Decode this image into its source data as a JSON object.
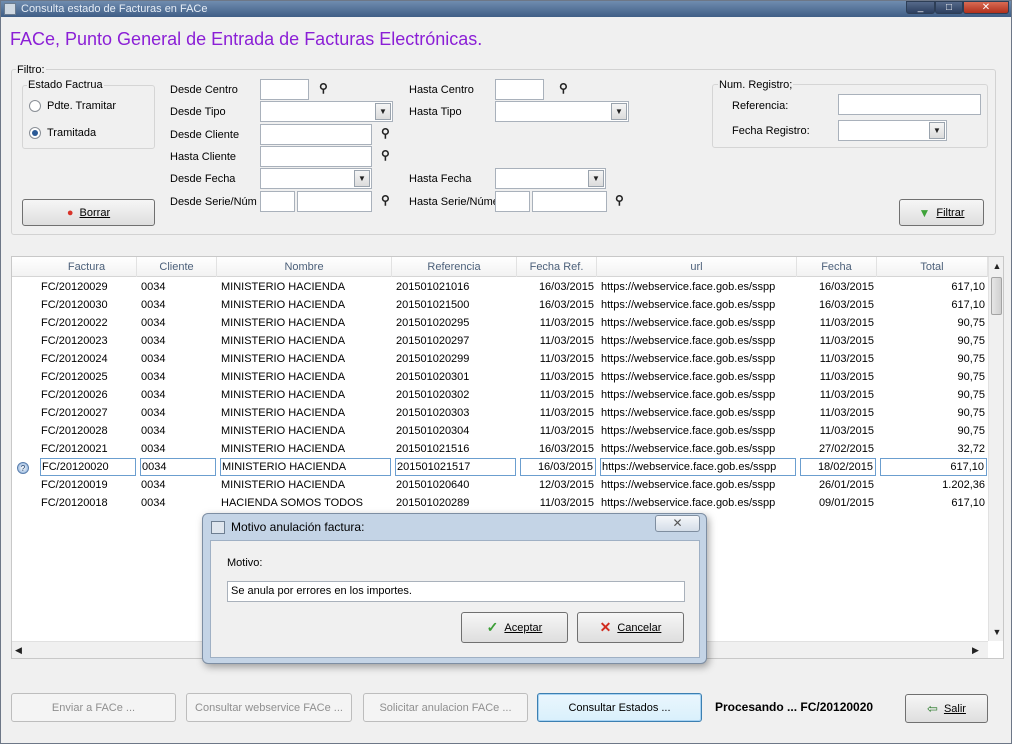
{
  "window": {
    "title": "Consulta estado de Facturas en FACe",
    "controls": [
      "_",
      "□",
      "✕"
    ]
  },
  "header": {
    "title": "FACe, Punto General de Entrada de Facturas Electrónicas."
  },
  "filter": {
    "legend": "Filtro:",
    "estado": {
      "legend": "Estado Factrua",
      "option1": "Pdte. Tramitar",
      "option2": "Tramitada",
      "selected": "Tramitada"
    },
    "labels": {
      "desde_centro": "Desde Centro",
      "hasta_centro": "Hasta Centro",
      "desde_tipo": "Desde Tipo",
      "hasta_tipo": "Hasta Tipo",
      "desde_cliente": "Desde Cliente",
      "hasta_cliente": "Hasta Cliente",
      "desde_fecha": "Desde Fecha",
      "hasta_fecha": "Hasta Fecha",
      "desde_serie": "Desde Serie/Núm",
      "hasta_serie": "Hasta Serie/Núme"
    },
    "registro": {
      "legend": "Num. Registro;",
      "referencia": "Referencia:",
      "fecha_registro": "Fecha Registro:"
    },
    "binoculars": "⚲",
    "borrar_label": "Borrar",
    "filtrar_label": "Filtrar"
  },
  "grid": {
    "columns": [
      "Factura",
      "Cliente",
      "Nombre",
      "Referencia",
      "Fecha Ref.",
      "url",
      "Fecha",
      "Total"
    ],
    "rows": [
      [
        "FC/20120029",
        "0034",
        "MINISTERIO HACIENDA",
        "201501021016",
        "16/03/2015",
        "https://webservice.face.gob.es/sspp",
        "16/03/2015",
        "617,10"
      ],
      [
        "FC/20120030",
        "0034",
        "MINISTERIO HACIENDA",
        "201501021500",
        "16/03/2015",
        "https://webservice.face.gob.es/sspp",
        "16/03/2015",
        "617,10"
      ],
      [
        "FC/20120022",
        "0034",
        "MINISTERIO HACIENDA",
        "201501020295",
        "11/03/2015",
        "https://webservice.face.gob.es/sspp",
        "11/03/2015",
        "90,75"
      ],
      [
        "FC/20120023",
        "0034",
        "MINISTERIO HACIENDA",
        "201501020297",
        "11/03/2015",
        "https://webservice.face.gob.es/sspp",
        "11/03/2015",
        "90,75"
      ],
      [
        "FC/20120024",
        "0034",
        "MINISTERIO HACIENDA",
        "201501020299",
        "11/03/2015",
        "https://webservice.face.gob.es/sspp",
        "11/03/2015",
        "90,75"
      ],
      [
        "FC/20120025",
        "0034",
        "MINISTERIO HACIENDA",
        "201501020301",
        "11/03/2015",
        "https://webservice.face.gob.es/sspp",
        "11/03/2015",
        "90,75"
      ],
      [
        "FC/20120026",
        "0034",
        "MINISTERIO HACIENDA",
        "201501020302",
        "11/03/2015",
        "https://webservice.face.gob.es/sspp",
        "11/03/2015",
        "90,75"
      ],
      [
        "FC/20120027",
        "0034",
        "MINISTERIO HACIENDA",
        "201501020303",
        "11/03/2015",
        "https://webservice.face.gob.es/sspp",
        "11/03/2015",
        "90,75"
      ],
      [
        "FC/20120028",
        "0034",
        "MINISTERIO HACIENDA",
        "201501020304",
        "11/03/2015",
        "https://webservice.face.gob.es/sspp",
        "11/03/2015",
        "90,75"
      ],
      [
        "FC/20120021",
        "0034",
        "MINISTERIO HACIENDA",
        "201501021516",
        "16/03/2015",
        "https://webservice.face.gob.es/sspp",
        "27/02/2015",
        "32,72"
      ],
      [
        "FC/20120020",
        "0034",
        "MINISTERIO HACIENDA",
        "201501021517",
        "16/03/2015",
        "https://webservice.face.gob.es/sspp",
        "18/02/2015",
        "617,10"
      ],
      [
        "FC/20120019",
        "0034",
        "MINISTERIO HACIENDA",
        "201501020640",
        "12/03/2015",
        "https://webservice.face.gob.es/sspp",
        "26/01/2015",
        "1.202,36"
      ],
      [
        "FC/20120018",
        "0034",
        "HACIENDA SOMOS TODOS",
        "201501020289",
        "11/03/2015",
        "https://webservice.face.gob.es/sspp",
        "09/01/2015",
        "617,10"
      ]
    ],
    "selected_row": 10
  },
  "dialog": {
    "title": "Motivo anulación factura:",
    "close": "✕",
    "field_label": "Motivo:",
    "field_value": "Se anula por errores en los importes.",
    "accept_label": "Aceptar",
    "cancel_label": "Cancelar"
  },
  "footer": {
    "enviar_label": "Enviar a FACe ...",
    "consultar_ws_label": "Consultar webservice FACe ...",
    "solicitar_label": "Solicitar anulacion FACe ...",
    "consultar_estados_label": "Consultar Estados ...",
    "status_text": "Procesando ... FC/20120020",
    "salir_label": "Salir"
  }
}
